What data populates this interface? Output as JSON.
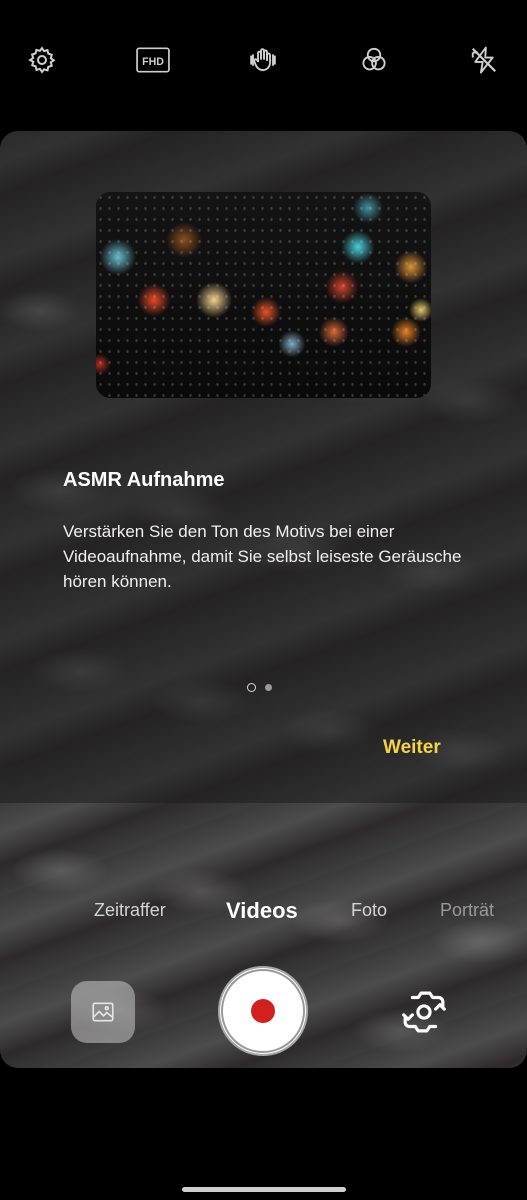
{
  "toolbar": {
    "settings_icon": "gear-icon",
    "resolution_label": "FHD",
    "stabilization_icon": "hand-icon",
    "filters_icon": "filters-icon",
    "flash_icon": "flash-off-icon"
  },
  "card": {
    "title": "ASMR Aufnahme",
    "description": "Verstärken Sie den Ton des Motivs bei einer Videoaufnahme, damit Sie selbst leiseste Geräusche hören können.",
    "page_current": 1,
    "page_total": 2,
    "next_label": "Weiter"
  },
  "modes": {
    "items": [
      {
        "label": "Zeitraffer",
        "active": false
      },
      {
        "label": "Videos",
        "active": true
      },
      {
        "label": "Foto",
        "active": false
      },
      {
        "label": "Porträt",
        "active": false
      }
    ]
  },
  "controls": {
    "gallery_icon": "gallery-icon",
    "shutter_icon": "record-icon",
    "flip_icon": "switch-camera-icon"
  },
  "colors": {
    "accent": "#f7d14a",
    "record": "#d21f1f"
  }
}
